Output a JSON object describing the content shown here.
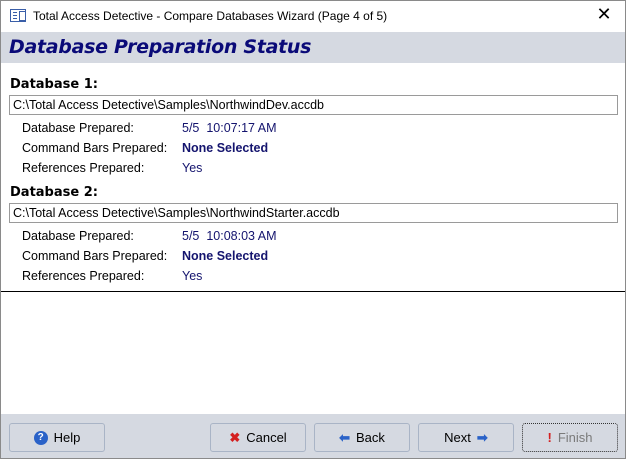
{
  "window": {
    "title": "Total Access Detective - Compare Databases Wizard (Page 4 of 5)",
    "close_icon": "close-icon"
  },
  "header": {
    "title": "Database Preparation Status"
  },
  "databases": [
    {
      "heading": "Database 1:",
      "path": "C:\\Total Access Detective\\Samples\\NorthwindDev.accdb",
      "rows": [
        {
          "label": "Database Prepared:",
          "value": "5/5  10:07:17 AM"
        },
        {
          "label": "Command Bars Prepared:",
          "value": "None Selected"
        },
        {
          "label": "References Prepared:",
          "value": "Yes"
        }
      ]
    },
    {
      "heading": "Database 2:",
      "path": "C:\\Total Access Detective\\Samples\\NorthwindStarter.accdb",
      "rows": [
        {
          "label": "Database Prepared:",
          "value": "5/5  10:08:03 AM"
        },
        {
          "label": "Command Bars Prepared:",
          "value": "None Selected"
        },
        {
          "label": "References Prepared:",
          "value": "Yes"
        }
      ]
    }
  ],
  "buttons": {
    "help": "Help",
    "cancel": "Cancel",
    "back": "Back",
    "next": "Next",
    "finish": "Finish"
  },
  "colors": {
    "header_bg": "#d5d9e1",
    "title_color": "#0a0a78",
    "value_color": "#14146e"
  }
}
